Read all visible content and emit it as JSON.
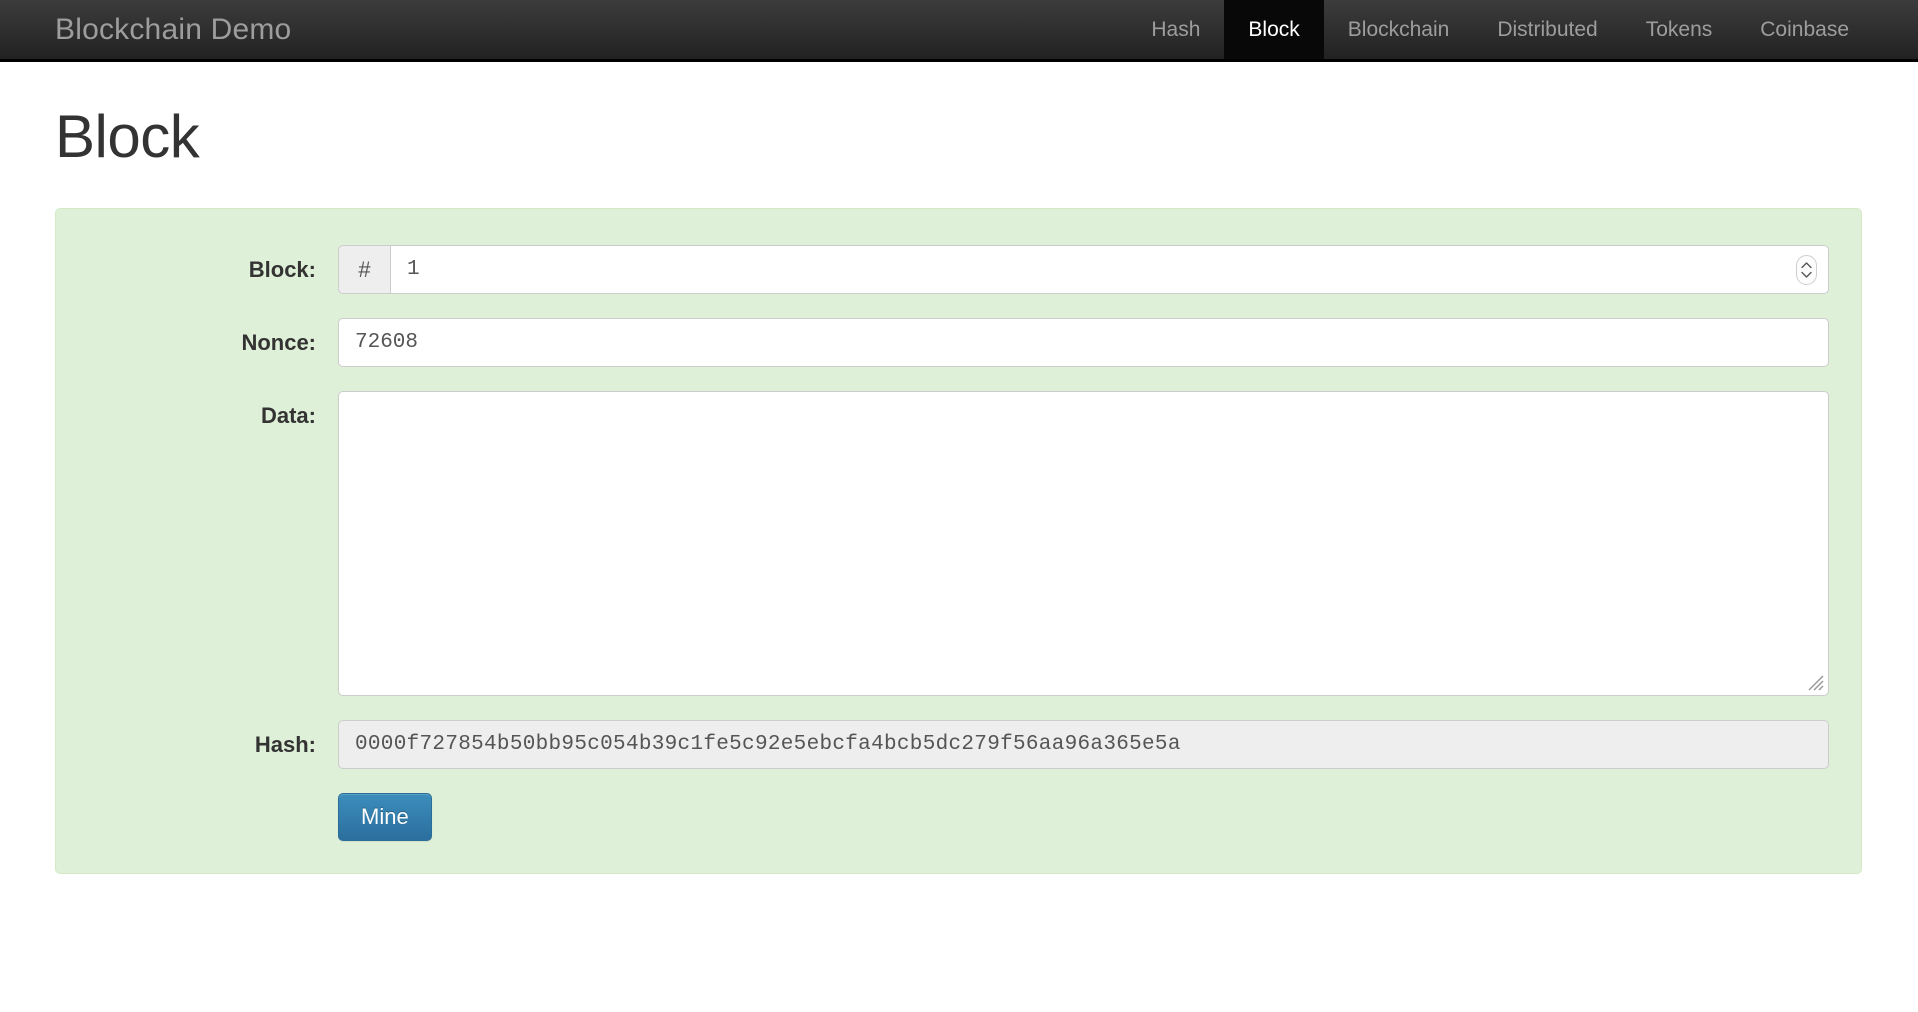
{
  "navbar": {
    "brand": "Blockchain Demo",
    "items": [
      {
        "label": "Hash",
        "active": false
      },
      {
        "label": "Block",
        "active": true
      },
      {
        "label": "Blockchain",
        "active": false
      },
      {
        "label": "Distributed",
        "active": false
      },
      {
        "label": "Tokens",
        "active": false
      },
      {
        "label": "Coinbase",
        "active": false
      }
    ]
  },
  "page": {
    "title": "Block"
  },
  "form": {
    "block": {
      "label": "Block:",
      "addon": "#",
      "value": "1",
      "placeholder": "",
      "type": "number",
      "spinner_icon": "spinner-up-down-icon"
    },
    "nonce": {
      "label": "Nonce:",
      "value": "72608",
      "placeholder": ""
    },
    "data": {
      "label": "Data:",
      "value": "",
      "placeholder": "",
      "resize_icon": "resize-handle-icon"
    },
    "hash": {
      "label": "Hash:",
      "value": "0000f727854b50bb95c054b39c1fe5c92e5ebcfa4bcb5dc279f56aa96a365e5a",
      "readonly": true
    },
    "mine_button": {
      "label": "Mine"
    }
  },
  "colors": {
    "navbar_top": "#3c3c3c",
    "navbar_bottom": "#222222",
    "nav_text": "#9d9d9d",
    "nav_active_bg": "#080808",
    "panel_bg": "#dff0d8",
    "panel_border": "#d6e9c6",
    "input_border": "#cccccc",
    "readonly_bg": "#eeeeee",
    "button_bg": "#337ab7",
    "title_text": "#333333"
  }
}
